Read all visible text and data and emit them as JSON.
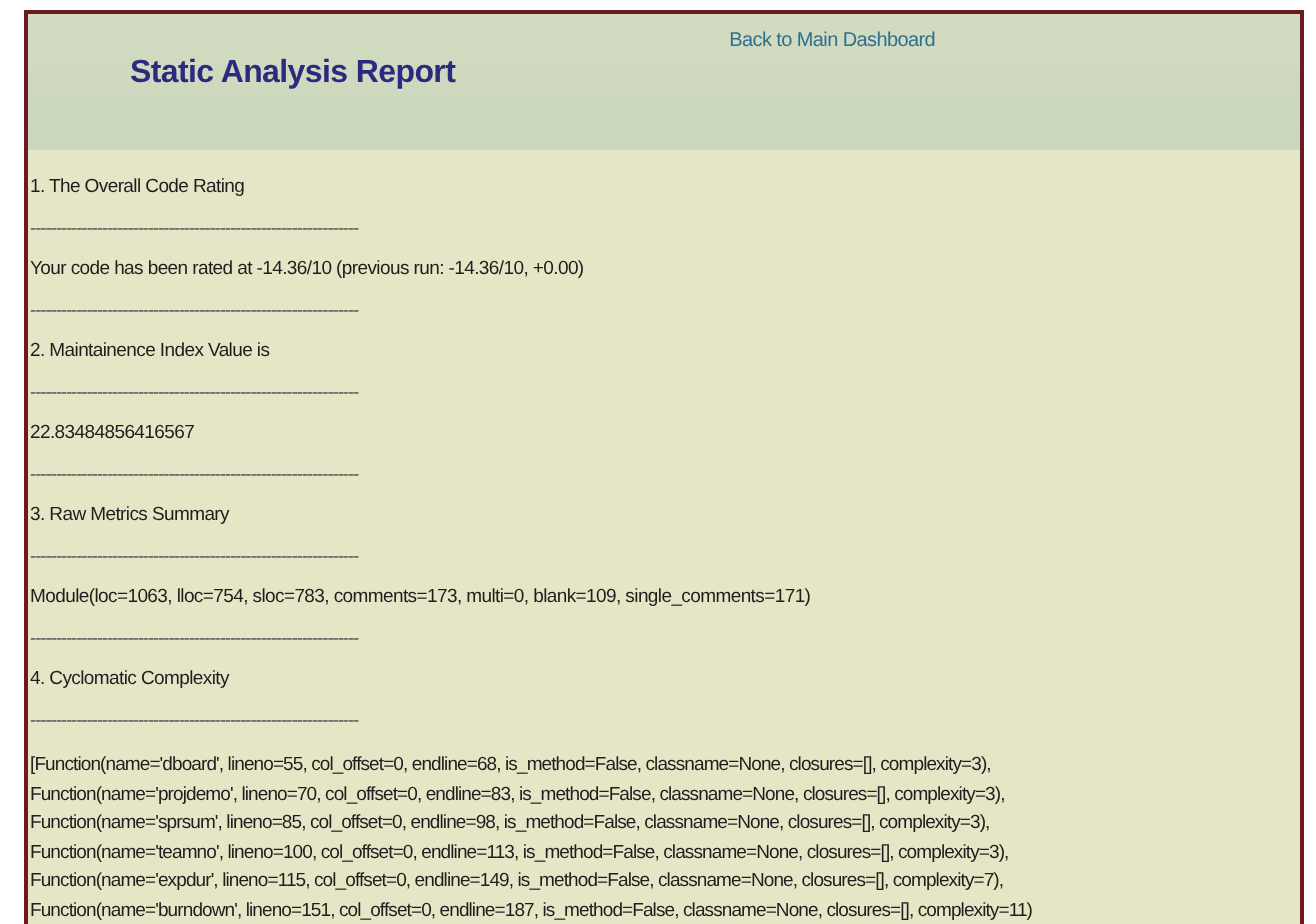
{
  "header": {
    "title": "Static Analysis Report",
    "link": "Back to Main Dashboard"
  },
  "lines": [
    {
      "kind": "heading",
      "text": "1. The Overall Code Rating"
    },
    {
      "kind": "divider",
      "text": "----------------------------------------------------------------"
    },
    {
      "kind": "text",
      "text": "Your code has been rated at -14.36/10 (previous run: -14.36/10, +0.00)"
    },
    {
      "kind": "divider",
      "text": "----------------------------------------------------------------"
    },
    {
      "kind": "heading",
      "text": "2. Maintainence Index Value is"
    },
    {
      "kind": "divider",
      "text": "----------------------------------------------------------------"
    },
    {
      "kind": "text",
      "text": "22.83484856416567"
    },
    {
      "kind": "divider",
      "text": "----------------------------------------------------------------"
    },
    {
      "kind": "heading",
      "text": "3. Raw Metrics Summary"
    },
    {
      "kind": "divider",
      "text": "----------------------------------------------------------------"
    },
    {
      "kind": "text",
      "text": "Module(loc=1063, lloc=754, sloc=783, comments=173, multi=0, blank=109, single_comments=171)"
    },
    {
      "kind": "divider",
      "text": "----------------------------------------------------------------"
    },
    {
      "kind": "heading",
      "text": "4. Cyclomatic Complexity"
    },
    {
      "kind": "divider",
      "text": "----------------------------------------------------------------"
    },
    {
      "kind": "code",
      "rows": [
        "[Function(name='dboard', lineno=55, col_offset=0, endline=68, is_method=False, classname=None, closures=[], complexity=3),",
        "Function(name='projdemo', lineno=70, col_offset=0, endline=83, is_method=False, classname=None, closures=[], complexity=3),",
        "Function(name='sprsum', lineno=85, col_offset=0, endline=98, is_method=False, classname=None, closures=[], complexity=3),",
        "Function(name='teamno', lineno=100, col_offset=0, endline=113, is_method=False, classname=None, closures=[], complexity=3),",
        "Function(name='expdur', lineno=115, col_offset=0, endline=149, is_method=False, classname=None, closures=[], complexity=7),",
        "Function(name='burndown', lineno=151, col_offset=0, endline=187, is_method=False, classname=None, closures=[], complexity=11)"
      ]
    }
  ]
}
